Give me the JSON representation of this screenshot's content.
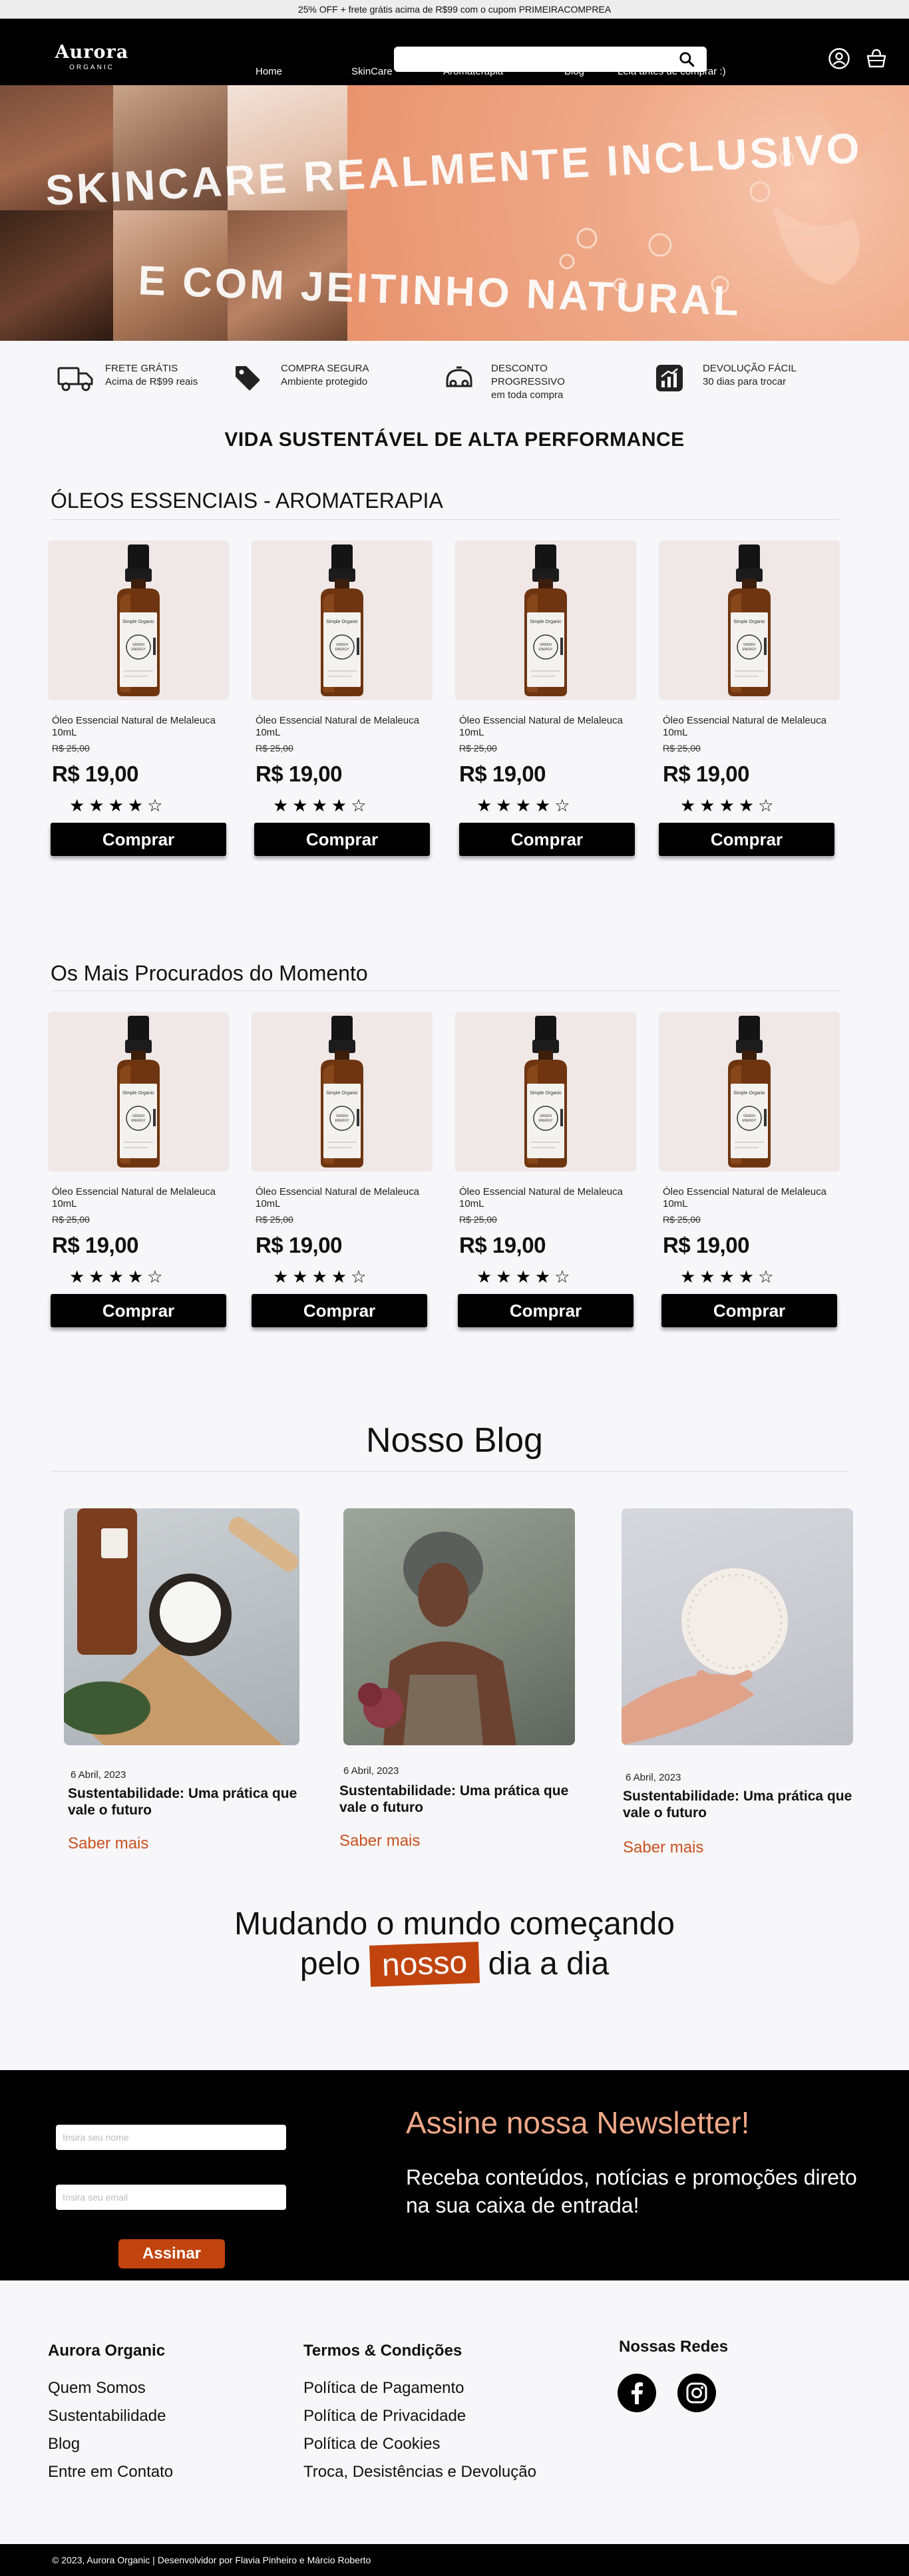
{
  "announcement": "25% OFF + frete grátis acima de R$99 com o cupom PRIMEIRACOMPREA",
  "header": {
    "brand": "Aurora",
    "brand_sub": "ORGANIC",
    "search": {
      "value": "",
      "placeholder": ""
    },
    "nav": [
      "Home",
      "SkinCare",
      "Aromaterapia",
      "Blog",
      "Leia antes de comprar :)"
    ]
  },
  "hero": {
    "line1": "SKINCARE REALMENTE INCLUSIVO",
    "line2": "E COM JEITINHO NATURAL"
  },
  "benefits": [
    {
      "icon": "truck-icon",
      "title": "FRETE GRÁTIS",
      "subtitle": "Acima de R$99 reais"
    },
    {
      "icon": "tag-icon",
      "title": "COMPRA SEGURA",
      "subtitle": "Ambiente protegido"
    },
    {
      "icon": "discount-icon",
      "title": "DESCONTO PROGRESSIVO",
      "subtitle": "em toda compra"
    },
    {
      "icon": "growth-chart-icon",
      "title": "DEVOLUÇÃO FÁCIL",
      "subtitle": "30 dias para trocar"
    }
  ],
  "tagline": "VIDA SUSTENTÁVEL DE ALTA PERFORMANCE",
  "sections": [
    {
      "title": "ÓLEOS ESSENCIAIS - AROMATERAPIA",
      "products": [
        {
          "name": "Óleo Essencial Natural de Melaleuca 10mL",
          "old_price": "R$ 25,00",
          "price": "R$ 19,00",
          "rating": 4,
          "rating_max": 5,
          "stars": "★★★★☆",
          "button": "Comprar"
        },
        {
          "name": "Óleo Essencial Natural de Melaleuca 10mL",
          "old_price": "R$ 25,00",
          "price": "R$ 19,00",
          "rating": 4,
          "rating_max": 5,
          "stars": "★★★★☆",
          "button": "Comprar"
        },
        {
          "name": "Óleo Essencial Natural de Melaleuca 10mL",
          "old_price": "R$ 25,00",
          "price": "R$ 19,00",
          "rating": 4,
          "rating_max": 5,
          "stars": "★★★★☆",
          "button": "Comprar"
        },
        {
          "name": "Óleo Essencial Natural de Melaleuca 10mL",
          "old_price": "R$ 25,00",
          "price": "R$ 19,00",
          "rating": 4,
          "rating_max": 5,
          "stars": "★★★★☆",
          "button": "Comprar"
        }
      ]
    },
    {
      "title": "Os Mais Procurados do Momento",
      "products": [
        {
          "name": "Óleo Essencial Natural de Melaleuca 10mL",
          "old_price": "R$ 25,00",
          "price": "R$ 19,00",
          "rating": 4,
          "rating_max": 5,
          "stars": "★★★★☆",
          "button": "Comprar"
        },
        {
          "name": "Óleo Essencial Natural de Melaleuca 10mL",
          "old_price": "R$ 25,00",
          "price": "R$ 19,00",
          "rating": 4,
          "rating_max": 5,
          "stars": "★★★★☆",
          "button": "Comprar"
        },
        {
          "name": "Óleo Essencial Natural de Melaleuca 10mL",
          "old_price": "R$ 25,00",
          "price": "R$ 19,00",
          "rating": 4,
          "rating_max": 5,
          "stars": "★★★★☆",
          "button": "Comprar"
        },
        {
          "name": "Óleo Essencial Natural de Melaleuca 10mL",
          "old_price": "R$ 25,00",
          "price": "R$ 19,00",
          "rating": 4,
          "rating_max": 5,
          "stars": "★★★★☆",
          "button": "Comprar"
        }
      ]
    }
  ],
  "product_label": {
    "brand": "Simple Organic",
    "seal": "GREEN ENERGY"
  },
  "blog": {
    "title": "Nosso Blog",
    "posts": [
      {
        "date": "6 Abril, 2023",
        "title": "Sustentabilidade: Uma prática que vale o futuro",
        "link": "Saber mais"
      },
      {
        "date": "6 Abril, 2023",
        "title": "Sustentabilidade: Uma prática que vale o futuro",
        "link": "Saber mais"
      },
      {
        "date": "6 Abril, 2023",
        "title": "Sustentabilidade: Uma prática que vale o futuro",
        "link": "Saber mais"
      }
    ]
  },
  "motto": {
    "line1": "Mudando o mundo começando",
    "pre": "pelo",
    "highlight": "nosso",
    "post": "dia a dia"
  },
  "newsletter": {
    "name_placeholder": "Insira seu nome",
    "email_placeholder": "Insira seu email",
    "button": "Assinar",
    "title": "Assine nossa Newsletter!",
    "description": "Receba conteúdos, notícias e promoções direto na sua caixa de entrada!"
  },
  "footer": {
    "col1_title": "Aurora Organic",
    "col1_links": [
      "Quem Somos",
      "Sustentabilidade",
      "Blog",
      "Entre em Contato"
    ],
    "col2_title": "Termos & Condições",
    "col2_links": [
      "Política de Pagamento",
      "Política de Privacidade",
      "Política de Cookies",
      "Troca, Desistências e Devolução"
    ],
    "social_title": "Nossas Redes",
    "social": [
      "facebook-icon",
      "instagram-icon"
    ]
  },
  "copyright": "© 2023, Aurora Organic | Desenvolvidor por Flavia Pinheiro e Márcio Roberto",
  "colors": {
    "accent": "#c1440e",
    "peach": "#f0a888",
    "dark": "#000000",
    "background": "#f7f7fa"
  }
}
